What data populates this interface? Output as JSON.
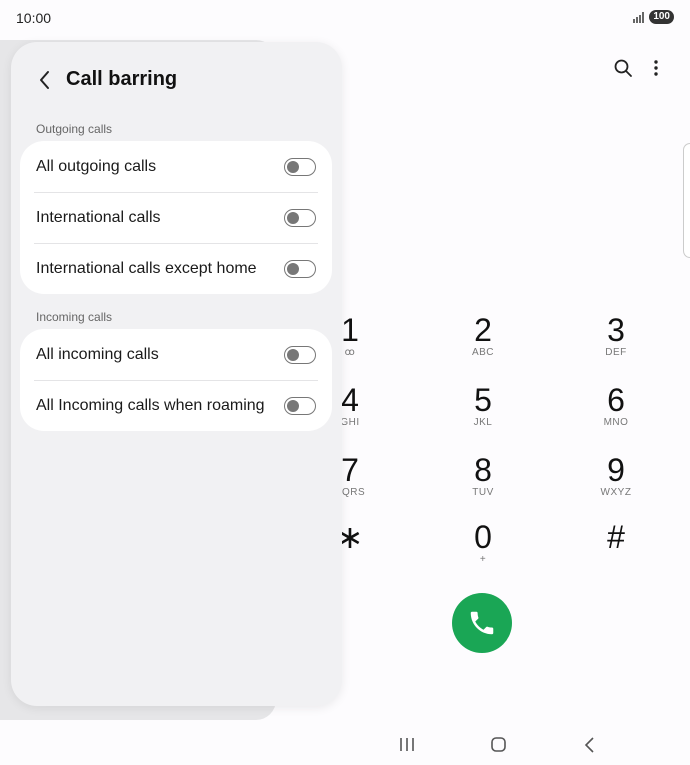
{
  "status_bar": {
    "time": "10:00",
    "battery": "100"
  },
  "dialer": {
    "keys": [
      {
        "digit": "1",
        "letters": "ꝏ"
      },
      {
        "digit": "2",
        "letters": "ABC"
      },
      {
        "digit": "3",
        "letters": "DEF"
      },
      {
        "digit": "4",
        "letters": "GHI"
      },
      {
        "digit": "5",
        "letters": "JKL"
      },
      {
        "digit": "6",
        "letters": "MNO"
      },
      {
        "digit": "7",
        "letters": "PQRS"
      },
      {
        "digit": "8",
        "letters": "TUV"
      },
      {
        "digit": "9",
        "letters": "WXYZ"
      },
      {
        "digit": "∗",
        "letters": ""
      },
      {
        "digit": "0",
        "letters": "+"
      },
      {
        "digit": "#",
        "letters": ""
      }
    ]
  },
  "panel": {
    "title": "Call barring",
    "outgoing_label": "Outgoing calls",
    "outgoing_items": [
      {
        "label": "All outgoing calls",
        "on": false
      },
      {
        "label": "International calls",
        "on": false
      },
      {
        "label": "International calls except home",
        "on": false
      }
    ],
    "incoming_label": "Incoming calls",
    "incoming_items": [
      {
        "label": "All incoming calls",
        "on": false
      },
      {
        "label": "All Incoming calls when roaming",
        "on": false
      }
    ]
  },
  "colors": {
    "call_button": "#1aa655",
    "panel_bg": "#f1f1f3"
  }
}
